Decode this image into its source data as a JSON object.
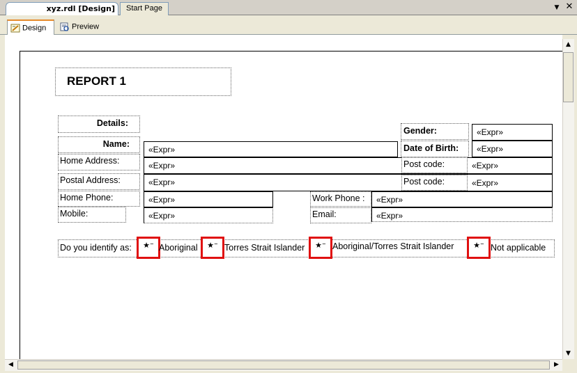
{
  "document_tabs": [
    {
      "label": "xyz.rdl [Design]",
      "active": true
    },
    {
      "label": "Start Page",
      "active": false
    }
  ],
  "view_tabs": [
    {
      "label": "Design",
      "icon": "design-icon",
      "active": true
    },
    {
      "label": "Preview",
      "icon": "preview-icon",
      "active": false
    }
  ],
  "report": {
    "title": "REPORT 1",
    "labels": {
      "details": "Details:",
      "name": "Name:",
      "home_address": "Home Address:",
      "postal_address": "Postal Address:",
      "home_phone": "Home Phone:",
      "mobile": "Mobile:",
      "gender": "Gender:",
      "dob": "Date of Birth:",
      "post_code_1": "Post code:",
      "post_code_2": "Post code:",
      "work_phone": "Work Phone :",
      "email": "Email:"
    },
    "expr": "«Expr»",
    "identify": {
      "question": "Do you identify as:",
      "options": [
        "Aboriginal",
        "Torres Strait Islander",
        "Aboriginal/Torres Strait Islander",
        "Not applicable"
      ],
      "checkbox_glyph": "★⁻"
    }
  },
  "colors": {
    "highlight": "#e01010",
    "tab_accent": "#e68b2c"
  }
}
